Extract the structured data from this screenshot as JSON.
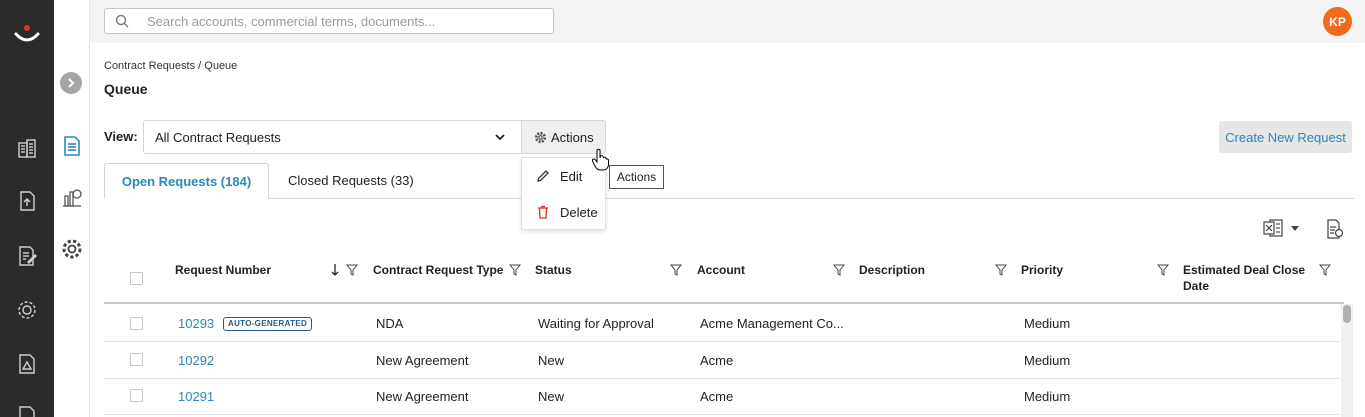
{
  "search": {
    "placeholder": "Search accounts, commercial terms, documents..."
  },
  "user": {
    "initials": "KP",
    "avatar_color": "#f26a1b"
  },
  "breadcrumb": "Contract Requests / Queue",
  "page_title": "Queue",
  "view": {
    "label": "View:",
    "selected": "All Contract Requests",
    "actions_label": "Actions"
  },
  "create_button": "Create New Request",
  "tabs": [
    {
      "label": "Open Requests (184)",
      "active": true
    },
    {
      "label": "Closed Requests (33)",
      "active": false
    }
  ],
  "actions_menu": [
    {
      "label": "Edit",
      "icon": "pencil-icon"
    },
    {
      "label": "Delete",
      "icon": "trash-icon"
    }
  ],
  "tooltip": "Actions",
  "table": {
    "columns": [
      "Request Number",
      "Contract Request Type",
      "Status",
      "Account",
      "Description",
      "Priority",
      "Estimated Deal Close Date"
    ],
    "rows": [
      {
        "number": "10293",
        "badge": "AUTO-GENERATED",
        "type": "NDA",
        "status": "Waiting for Approval",
        "account": "Acme Management Co...",
        "description": "",
        "priority": "Medium",
        "close_date": ""
      },
      {
        "number": "10292",
        "badge": "",
        "type": "New Agreement",
        "status": "New",
        "account": "Acme",
        "description": "",
        "priority": "Medium",
        "close_date": ""
      },
      {
        "number": "10291",
        "badge": "",
        "type": "New Agreement",
        "status": "New",
        "account": "Acme",
        "description": "",
        "priority": "Medium",
        "close_date": ""
      }
    ]
  },
  "colors": {
    "accent": "#2a89b8",
    "rail": "#2b2b2b",
    "brand_red": "#e8312a"
  }
}
